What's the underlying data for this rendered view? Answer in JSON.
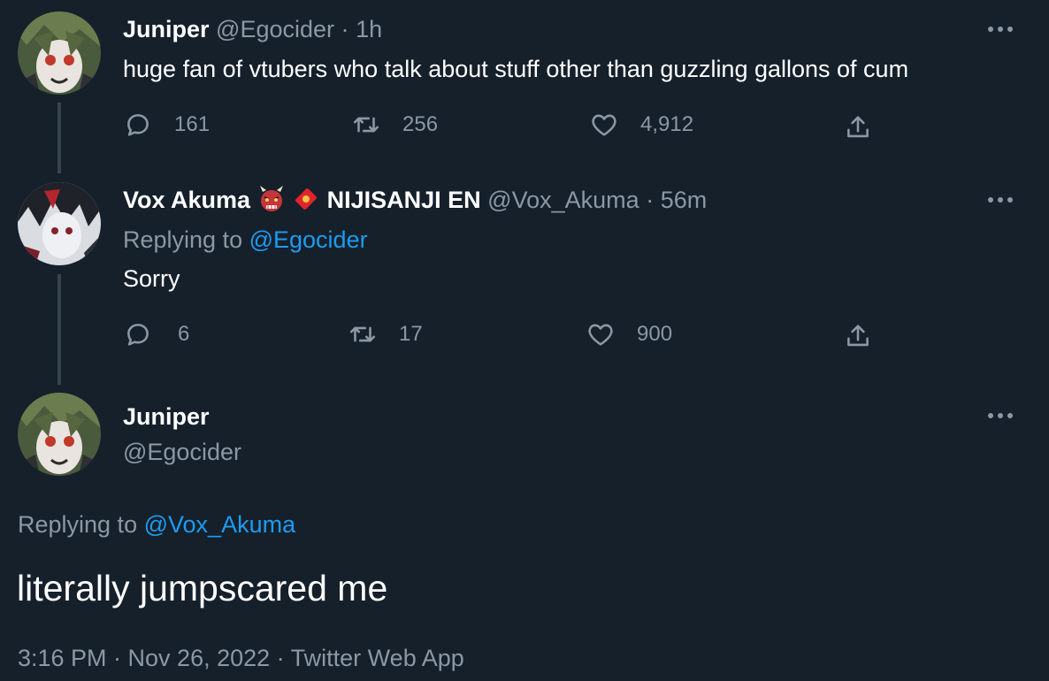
{
  "tweets": [
    {
      "name": "Juniper",
      "handle": "@Egocider",
      "separator": "·",
      "time": "1h",
      "text": "huge fan of vtubers who talk about stuff other than guzzling gallons of cum",
      "actions": {
        "replies": "161",
        "retweets": "256",
        "likes": "4,912"
      }
    },
    {
      "name": "Vox Akuma",
      "name_suffix": "NIJISANJI EN",
      "handle": "@Vox_Akuma",
      "separator": "·",
      "time": "56m",
      "replying_label": "Replying to",
      "replying_handle": "@Egocider",
      "text": "Sorry",
      "actions": {
        "replies": "6",
        "retweets": "17",
        "likes": "900"
      }
    }
  ],
  "main_tweet": {
    "name": "Juniper",
    "handle": "@Egocider",
    "replying_label": "Replying to",
    "replying_handle": "@Vox_Akuma",
    "text": "literally jumpscared me",
    "timestamp": "3:16 PM · Nov 26, 2022 · Twitter Web App"
  },
  "icons": {
    "more": "more-dots-icon",
    "reply": "reply-bubble-icon",
    "retweet": "retweet-arrows-icon",
    "like": "heart-icon",
    "share": "share-upload-icon",
    "emoji_1": "ogre-mask-icon",
    "emoji_2": "red-envelope-icon"
  },
  "colors": {
    "background": "#15202b",
    "text": "#ffffff",
    "muted": "#8b98a5",
    "link": "#1d9bf0",
    "thread_line": "#38444d"
  }
}
